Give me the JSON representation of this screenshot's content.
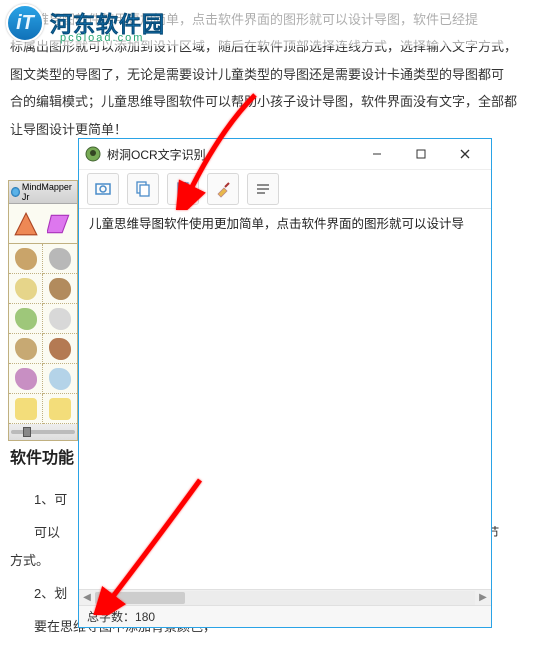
{
  "site": {
    "name": "河东软件园",
    "sub": "pc6load.com"
  },
  "article": {
    "p1": "童思维导图软件使用更加简单，点击软件界面的图形就可以设计导图，软件已经提",
    "p2": "标属出图形就可以添加到设计区域，随后在软件顶部选择连线方式，选择输入文字方式，",
    "p3": "图文类型的导图了，无论是需要设计儿童类型的导图还是需要设计卡通类型的导图都可",
    "p4": "合的编辑模式；儿童思维导图软件可以帮助小孩子设计导图，软件界面没有文字，全部都",
    "p5": "让导图设计更简单！",
    "section": "软件功能",
    "n1": "1、可",
    "mid": "可以",
    "tail1": "颜色。节",
    "mid2": "方式。",
    "n2": "2、划",
    "last": "要在思维导图中添加背景颜色，"
  },
  "palette": {
    "title": "MindMapper Jr"
  },
  "ocr": {
    "title": "树洞OCR文字识别",
    "content": "儿童思维导图软件使用更加简单，点击软件界面的图形就可以设计导",
    "status_label": "总字数：",
    "status_value": "180"
  }
}
